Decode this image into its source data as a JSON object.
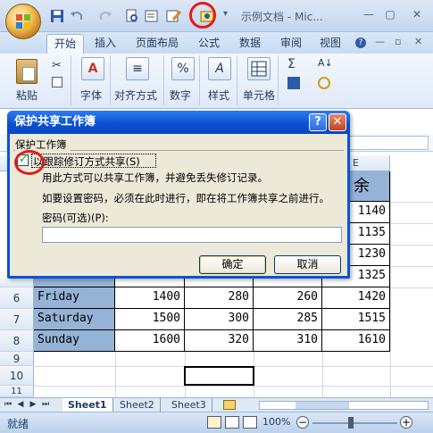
{
  "window": {
    "title": "示例文档 - Mic...",
    "minimize": "—",
    "restore": "▢",
    "close": "✕"
  },
  "ribbon": {
    "tabs": [
      "开始",
      "插入",
      "页面布局",
      "公式",
      "数据",
      "审阅",
      "视图"
    ],
    "groups": {
      "paste": "粘贴",
      "font": "字体",
      "alignment": "对齐方式",
      "number": "数字",
      "styles": "样式",
      "cells": "单元格"
    },
    "icons": {
      "cut": "✂",
      "font": "A",
      "align": "≡",
      "percent": "%",
      "styles": "A",
      "sum": "Σ",
      "sort": "A↓"
    }
  },
  "columns": {
    "e": "E"
  },
  "rows": [
    {
      "num": "6",
      "day": "Friday",
      "b": "1400",
      "c": "280",
      "d": "260",
      "e": "1420"
    },
    {
      "num": "7",
      "day": "Saturday",
      "b": "1500",
      "c": "300",
      "d": "285",
      "e": "1515"
    },
    {
      "num": "8",
      "day": "Sunday",
      "b": "1600",
      "c": "320",
      "d": "310",
      "e": "1610"
    }
  ],
  "partial_values": {
    "e_header_fragment": "余",
    "e_values": [
      "1140",
      "1135",
      "1230",
      "1325"
    ],
    "row_headers_below": [
      "9",
      "10",
      "11"
    ]
  },
  "sheets": [
    "Sheet1",
    "Sheet2",
    "Sheet3"
  ],
  "status": {
    "ready": "就绪",
    "zoom": "100%"
  },
  "dialog": {
    "title": "保护共享工作簿",
    "help": "?",
    "close": "✕",
    "group_label": "保护工作簿",
    "checkbox_label": "以跟踪修订方式共享(S)",
    "checkbox_checked": true,
    "description": "用此方式可以共享工作簿，并避免丢失修订记录。",
    "password_note": "如要设置密码，必须在此时进行，即在将工作簿共享之前进行。",
    "password_label": "密码(可选)(P):",
    "password_value": "",
    "ok": "确定",
    "cancel": "取消"
  },
  "colors": {
    "dialog_title": "#0a4fd1",
    "header_fill": "#95b3d7",
    "annotation": "#e31b1b"
  }
}
